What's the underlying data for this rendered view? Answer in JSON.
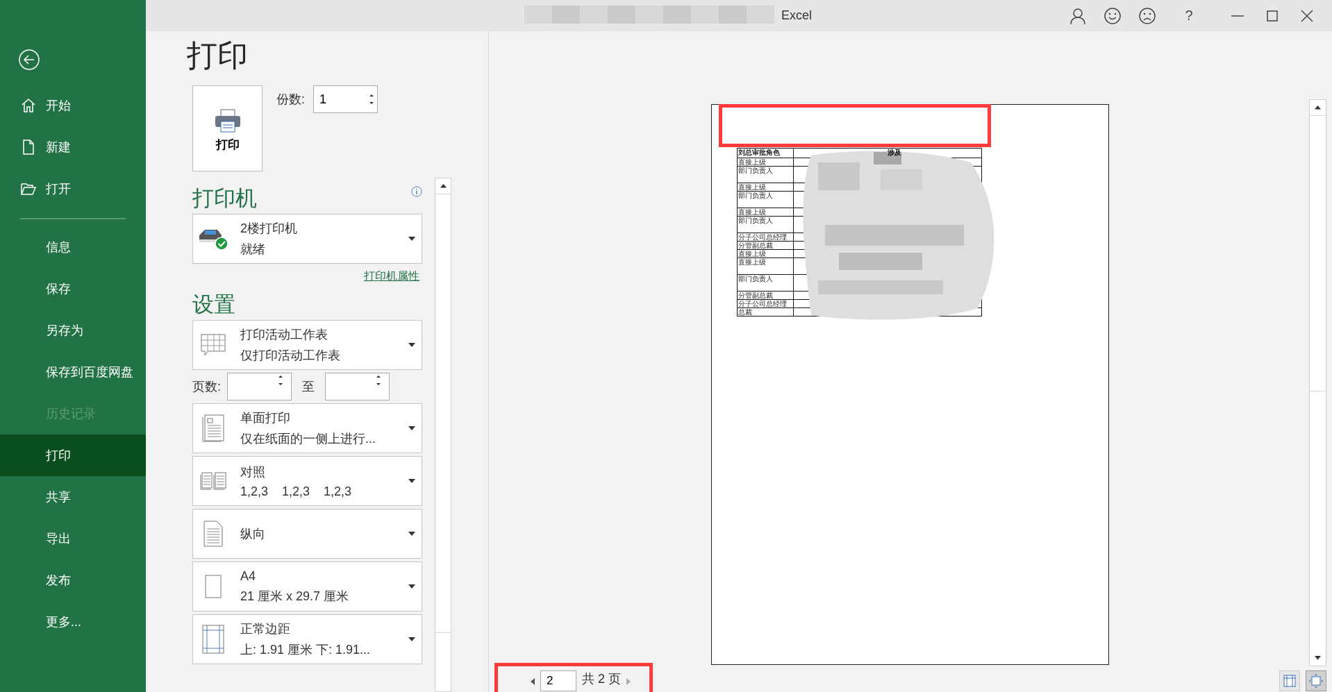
{
  "title_bar": {
    "title": "Excel",
    "buttons": [
      {
        "kind": "account"
      },
      {
        "kind": "smile"
      },
      {
        "kind": "frown"
      },
      {
        "kind": "help",
        "label": "?"
      },
      {
        "kind": "minimize"
      },
      {
        "kind": "maximize"
      },
      {
        "kind": "close"
      }
    ]
  },
  "sidebar": {
    "items": [
      {
        "kind": "back"
      },
      {
        "kind": "home",
        "label": "开始",
        "selected": false,
        "disabled": false
      },
      {
        "kind": "new",
        "label": "新建",
        "selected": false,
        "disabled": false
      },
      {
        "kind": "open",
        "label": "打开",
        "selected": false,
        "disabled": false
      },
      {
        "kind": "divider"
      },
      {
        "kind": "nav",
        "label": "信息",
        "selected": false,
        "disabled": false
      },
      {
        "kind": "nav",
        "label": "保存",
        "selected": false,
        "disabled": false
      },
      {
        "kind": "nav",
        "label": "另存为",
        "selected": false,
        "disabled": false
      },
      {
        "kind": "nav",
        "label": "保存到百度网盘",
        "selected": false,
        "disabled": false
      },
      {
        "kind": "nav",
        "label": "历史记录",
        "selected": false,
        "disabled": true
      },
      {
        "kind": "nav",
        "label": "打印",
        "selected": true,
        "disabled": false
      },
      {
        "kind": "nav",
        "label": "共享",
        "selected": false,
        "disabled": false
      },
      {
        "kind": "nav",
        "label": "导出",
        "selected": false,
        "disabled": false
      },
      {
        "kind": "nav",
        "label": "发布",
        "selected": false,
        "disabled": false
      },
      {
        "kind": "nav",
        "label": "更多...",
        "selected": false,
        "disabled": false
      }
    ]
  },
  "print_panel": {
    "heading": "打印",
    "print_button": "打印",
    "copies": {
      "label": "份数:",
      "value": "1"
    },
    "printer": {
      "heading": "打印机",
      "name": "2楼打印机",
      "status": "就绪",
      "ready": true,
      "properties_link": "打印机属性"
    },
    "settings": {
      "heading": "设置",
      "items": [
        {
          "kind": "sheet",
          "line1": "打印活动工作表",
          "line2": "仅打印活动工作表"
        },
        {
          "kind": "range",
          "label": "页数:",
          "to": "至"
        },
        {
          "kind": "sides",
          "line1": "单面打印",
          "line2": "仅在纸面的一侧上进行..."
        },
        {
          "kind": "collate",
          "line1": "对照",
          "line2": "1,2,3    1,2,3    1,2,3"
        },
        {
          "kind": "orientation",
          "line1": "纵向"
        },
        {
          "kind": "paper",
          "line1": "A4",
          "line2": "21 厘米 x 29.7 厘米"
        },
        {
          "kind": "margins",
          "line1": "正常边距",
          "line2": "上: 1.91 厘米 下: 1.91..."
        }
      ]
    }
  },
  "preview": {
    "sheet": {
      "columns": [
        "刘总审批角色",
        "涉及"
      ],
      "rows": [
        {
          "label": "直接上级",
          "tall": false
        },
        {
          "label": "部门负责人",
          "tall": true
        },
        {
          "label": "直接上级",
          "tall": false
        },
        {
          "label": "部门负责人",
          "tall": true
        },
        {
          "label": "直接上级",
          "tall": false
        },
        {
          "label": "部门负责人",
          "tall": true
        },
        {
          "label": "分子公司总经理",
          "tall": false
        },
        {
          "label": "分管副总裁",
          "tall": false
        },
        {
          "label": "直接上级",
          "tall": false
        },
        {
          "label": "直接上级",
          "tall": true
        },
        {
          "label": "部门负责人",
          "tall": true
        },
        {
          "label": "分管副总裁",
          "tall": false
        },
        {
          "label": "分子公司总经理",
          "tall": false
        },
        {
          "label": "总裁",
          "tall": false
        }
      ]
    },
    "page_nav": {
      "current": "2",
      "total": "共 2 页"
    }
  }
}
